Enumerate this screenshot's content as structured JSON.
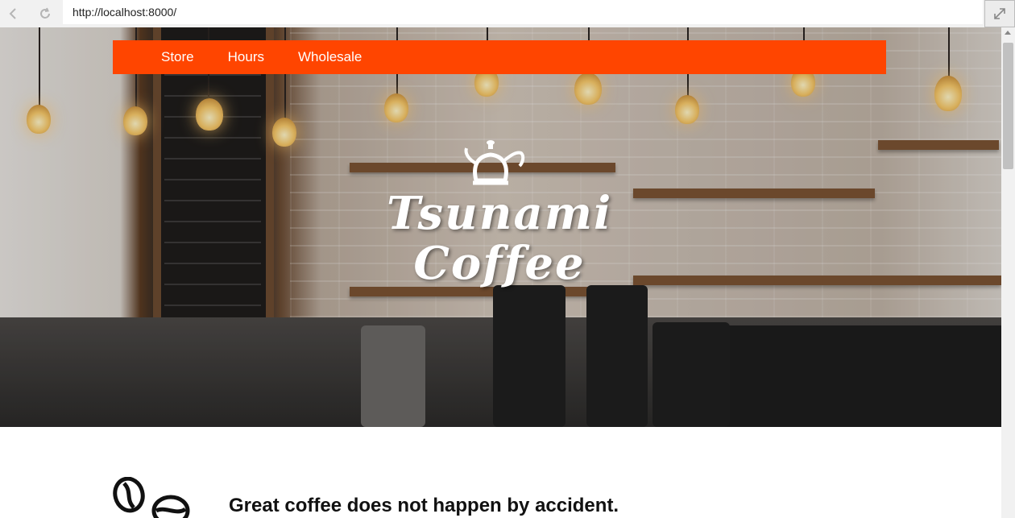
{
  "browser": {
    "url": "http://localhost:8000/",
    "back_icon": "chevron-left-icon",
    "reload_icon": "reload-icon",
    "expand_icon": "expand-icon"
  },
  "nav": {
    "items": [
      {
        "label": "Store"
      },
      {
        "label": "Hours"
      },
      {
        "label": "Wholesale"
      }
    ],
    "background": "#ff4500"
  },
  "hero": {
    "logo_icon": "kettle-icon",
    "logo_line1": "Tsunami",
    "logo_line2": "Coffee"
  },
  "main": {
    "icon": "coffee-beans-icon",
    "headline": "Great coffee does not happen by accident."
  }
}
